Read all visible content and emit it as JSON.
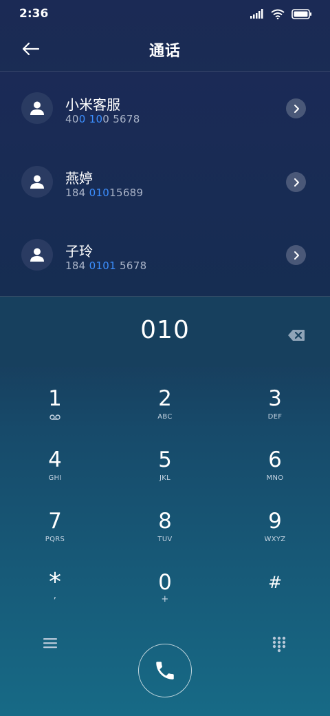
{
  "status_bar": {
    "time": "2:36"
  },
  "header": {
    "title": "通话"
  },
  "contacts": [
    {
      "name": "小米客服",
      "number_parts": [
        "40",
        "0",
        " ",
        "10",
        "0 5678"
      ]
    },
    {
      "name": "燕婷",
      "number_parts": [
        "184 ",
        "010",
        "15689"
      ]
    },
    {
      "name": "子玲",
      "number_parts": [
        "184 ",
        "0101",
        " 5678"
      ]
    }
  ],
  "dialer": {
    "input": "010",
    "keys": [
      {
        "digit": "1",
        "letters": ""
      },
      {
        "digit": "2",
        "letters": "ABC"
      },
      {
        "digit": "3",
        "letters": "DEF"
      },
      {
        "digit": "4",
        "letters": "GHI"
      },
      {
        "digit": "5",
        "letters": "JKL"
      },
      {
        "digit": "6",
        "letters": "MNO"
      },
      {
        "digit": "7",
        "letters": "PQRS"
      },
      {
        "digit": "8",
        "letters": "TUV"
      },
      {
        "digit": "9",
        "letters": "WXYZ"
      },
      {
        "digit": "*",
        "letters": ","
      },
      {
        "digit": "0",
        "letters": "+"
      },
      {
        "digit": "#",
        "letters": ""
      }
    ]
  },
  "colors": {
    "highlight": "#3c8fff",
    "accent_bg": "#17405e"
  },
  "icons": [
    "back-arrow-icon",
    "person-icon",
    "chevron-right-icon",
    "backspace-icon",
    "voicemail-icon",
    "menu-icon",
    "keypad-icon",
    "phone-icon",
    "signal-icon",
    "wifi-icon",
    "battery-icon"
  ]
}
